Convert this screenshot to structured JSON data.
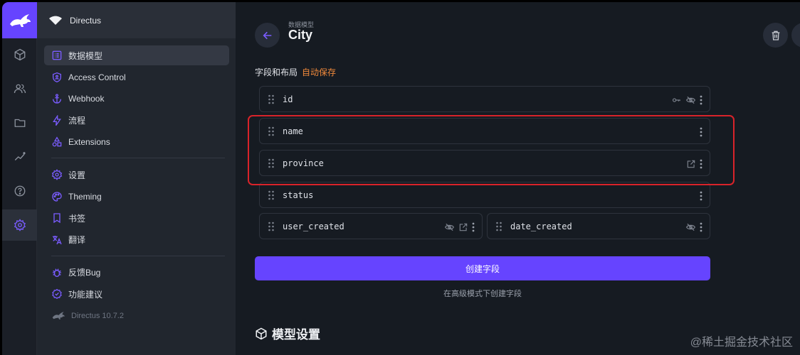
{
  "project": {
    "name": "Directus"
  },
  "nav": {
    "items": [
      {
        "label": "数据模型",
        "icon": "list-box-icon",
        "active": true
      },
      {
        "label": "Access Control",
        "icon": "shield-person-icon"
      },
      {
        "label": "Webhook",
        "icon": "anchor-icon"
      },
      {
        "label": "流程",
        "icon": "bolt-icon"
      },
      {
        "label": "Extensions",
        "icon": "shapes-icon"
      }
    ],
    "items2": [
      {
        "label": "设置",
        "icon": "gear-icon"
      },
      {
        "label": "Theming",
        "icon": "palette-icon"
      },
      {
        "label": "书签",
        "icon": "bookmark-icon"
      },
      {
        "label": "翻译",
        "icon": "translate-icon"
      }
    ],
    "items3": [
      {
        "label": "反馈Bug",
        "icon": "bug-icon"
      },
      {
        "label": "功能建议",
        "icon": "verified-icon"
      }
    ],
    "version": "Directus 10.7.2"
  },
  "header": {
    "breadcrumb": "数据模型",
    "title": "City"
  },
  "fields_section": {
    "title": "字段和布局",
    "autosave": "自动保存"
  },
  "fields": {
    "id": {
      "name": "id"
    },
    "name": {
      "name": "name"
    },
    "province": {
      "name": "province"
    },
    "status": {
      "name": "status"
    },
    "user_created": {
      "name": "user_created"
    },
    "date_created": {
      "name": "date_created"
    }
  },
  "actions": {
    "create_field": "创建字段",
    "advanced": "在高级模式下创建字段"
  },
  "model_settings": {
    "title": "模型设置"
  },
  "watermark": "@稀土掘金技术社区",
  "colors": {
    "accent": "#6644ff",
    "highlight": "#d9232a",
    "autosave": "#f0893b"
  }
}
